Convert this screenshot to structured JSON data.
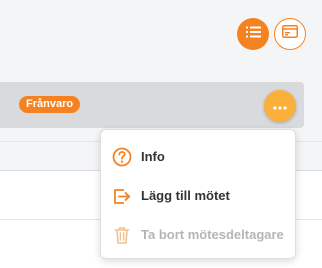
{
  "colors": {
    "accent": "#f58220",
    "accent_light": "#fbb03b",
    "disabled": "#b5b5b5"
  },
  "toolbar": {
    "list_view_icon": "list-icon",
    "card_view_icon": "card-icon"
  },
  "participant_row": {
    "status_badge": "Frånvaro",
    "more_icon": "more-horizontal-icon"
  },
  "context_menu": {
    "items": [
      {
        "label": "Info",
        "icon": "help-circle-icon",
        "enabled": true
      },
      {
        "label": "Lägg till mötet",
        "icon": "add-to-meeting-icon",
        "enabled": true
      },
      {
        "label": "Ta bort mötesdeltagare",
        "icon": "trash-icon",
        "enabled": false
      }
    ]
  }
}
